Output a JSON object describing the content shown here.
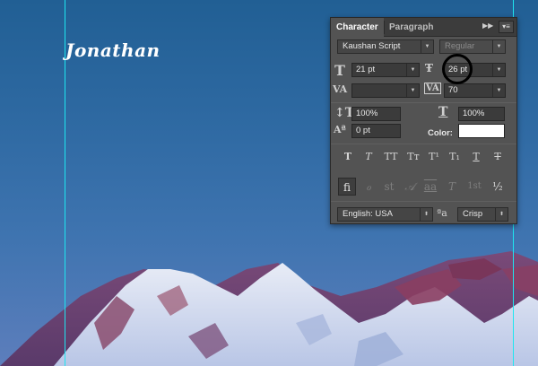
{
  "canvas": {
    "text_layer": "Jonathan",
    "guide_color": "#1ee6f0"
  },
  "panel": {
    "tabs": [
      "Character",
      "Paragraph"
    ],
    "collapse_icon": "double-chevron-right-icon",
    "menu_icon": "panel-menu-icon",
    "font_family": "Kaushan Script",
    "font_style": "Regular",
    "font_size": "21 pt",
    "leading": "26 pt",
    "kerning": "",
    "tracking": "70",
    "vertical_scale": "100%",
    "horizontal_scale": "100%",
    "baseline_shift": "0 pt",
    "color_label": "Color:",
    "text_color": "#ffffff",
    "type_styles": [
      "T",
      "T",
      "TT",
      "Tт",
      "T¹",
      "T₁",
      "T",
      "T"
    ],
    "opentype": [
      "ﬁ",
      "ℴ",
      "st",
      "𝒜",
      "aa",
      "T",
      "1st",
      "½"
    ],
    "language": "English: USA",
    "aa_icon": "ªa",
    "antialias": "Crisp"
  }
}
